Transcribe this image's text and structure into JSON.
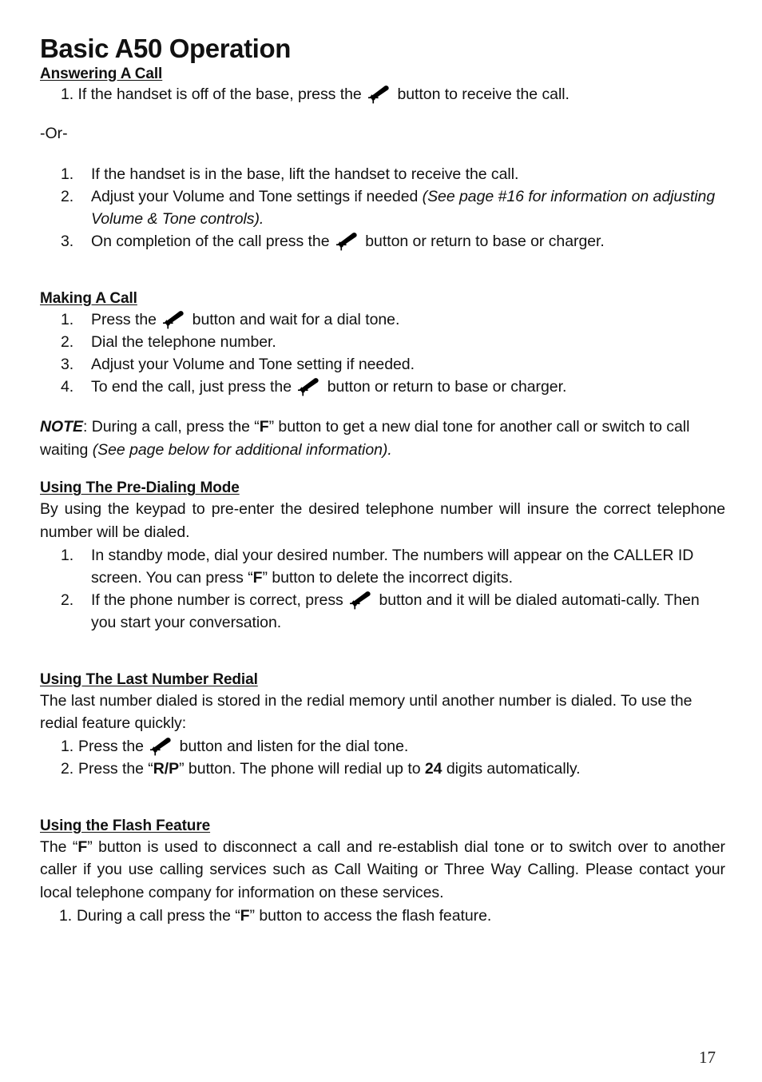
{
  "page": {
    "title": "Basic A50 Operation",
    "page_number": "17",
    "icon_name": "phone-handset-icon"
  },
  "sections": {
    "answering": {
      "heading": "Answering A Call",
      "item1_before": "1. If the handset is off of the base, press the",
      "item1_after": "button to receive the call.",
      "or": "-Or-",
      "list": [
        {
          "num": "1.",
          "text": "If the handset is in the base, lift the handset to receive the call."
        },
        {
          "num": "2.",
          "text": "Adjust your Volume and Tone settings if needed ",
          "italic": "(See page #16 for information on adjusting Volume & Tone controls)."
        },
        {
          "num": "3.",
          "before": "On completion of the call press the",
          "after": "button or return to base or charger."
        }
      ]
    },
    "making": {
      "heading": "Making A Call",
      "list": [
        {
          "num": "1.",
          "before": "Press the",
          "after": "button and wait for a dial tone."
        },
        {
          "num": "2.",
          "text": "Dial the telephone number."
        },
        {
          "num": "3.",
          "text": "Adjust your Volume and Tone setting if needed."
        },
        {
          "num": "4.",
          "before": "To end the call, just press the",
          "after": "button or return to base or charger."
        }
      ]
    },
    "note": {
      "label": "NOTE",
      "part1": ": During a call, press the “",
      "button": "F",
      "part2": "” button to get a new dial tone for another call or switch to call waiting ",
      "italic": "(See page below for additional information)."
    },
    "predialing": {
      "heading": "Using The Pre-Dialing Mode",
      "intro": "By using the keypad to pre-enter the desired telephone number will insure the correct telephone number will be dialed.",
      "list": [
        {
          "num": "1.",
          "part1": "In standby mode, dial your desired number. The numbers will appear on the CALLER ID screen. You can press “",
          "button": "F",
          "part2": "” button to delete the incorrect digits."
        },
        {
          "num": "2.",
          "before": "If the phone number is correct, press",
          "after": "button and it will be dialed automati-cally. Then you start your conversation."
        }
      ]
    },
    "redial": {
      "heading": "Using The Last Number Redial",
      "intro": "The last number dialed is stored in the redial memory until another number is dialed. To use the redial feature quickly:",
      "list": [
        {
          "num": "1.",
          "before": "Press the",
          "after": "button and listen for the dial tone."
        },
        {
          "num": "2.",
          "part1": "Press the “",
          "button": "R/P",
          "part2": "” button. The phone will redial up to ",
          "bold_number": "24",
          "part3": " digits automatically."
        }
      ]
    },
    "flash": {
      "heading": "Using the Flash Feature",
      "part1": "The “",
      "button": "F",
      "part2": "” button is used to disconnect a call and re-establish dial tone or to switch over to another caller if you use calling services such as Call Waiting or Three Way Calling. Please contact your local telephone company for information on these services.",
      "item": {
        "num": "1.",
        "part1": "During a call press the “",
        "button": "F",
        "part2": "” button to access the flash feature."
      }
    }
  }
}
